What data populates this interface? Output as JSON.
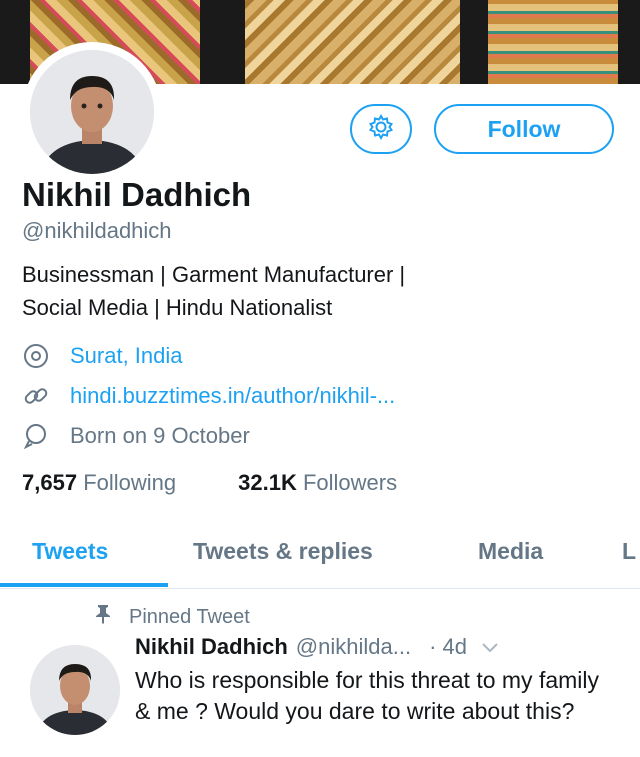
{
  "profile": {
    "name": "Nikhil Dadhich",
    "handle": "@nikhildadhich",
    "bio_line1": "Businessman | Garment Manufacturer |",
    "bio_line2": "Social Media | Hindu Nationalist",
    "location": "Surat, India",
    "website": "hindi.buzztimes.in/author/nikhil-...",
    "birthday": "Born on 9 October"
  },
  "actions": {
    "follow_label": "Follow",
    "settings_icon": "gear-icon"
  },
  "stats": {
    "following_count": "7,657",
    "following_label": "Following",
    "followers_count": "32.1K",
    "followers_label": "Followers"
  },
  "tabs": [
    {
      "label": "Tweets",
      "active": true
    },
    {
      "label": "Tweets & replies",
      "active": false
    },
    {
      "label": "Media",
      "active": false
    },
    {
      "label": "L",
      "active": false
    }
  ],
  "pinned_tweet": {
    "pinned_label": "Pinned Tweet",
    "author_name": "Nikhil Dadhich",
    "author_handle": "@nikhilda...",
    "time": "· 4d",
    "text": "Who is responsible for this threat to my family & me ? Would you dare to write about this?"
  },
  "colors": {
    "accent": "#1da1f2",
    "secondary_text": "#657786",
    "primary_text": "#14171a"
  }
}
